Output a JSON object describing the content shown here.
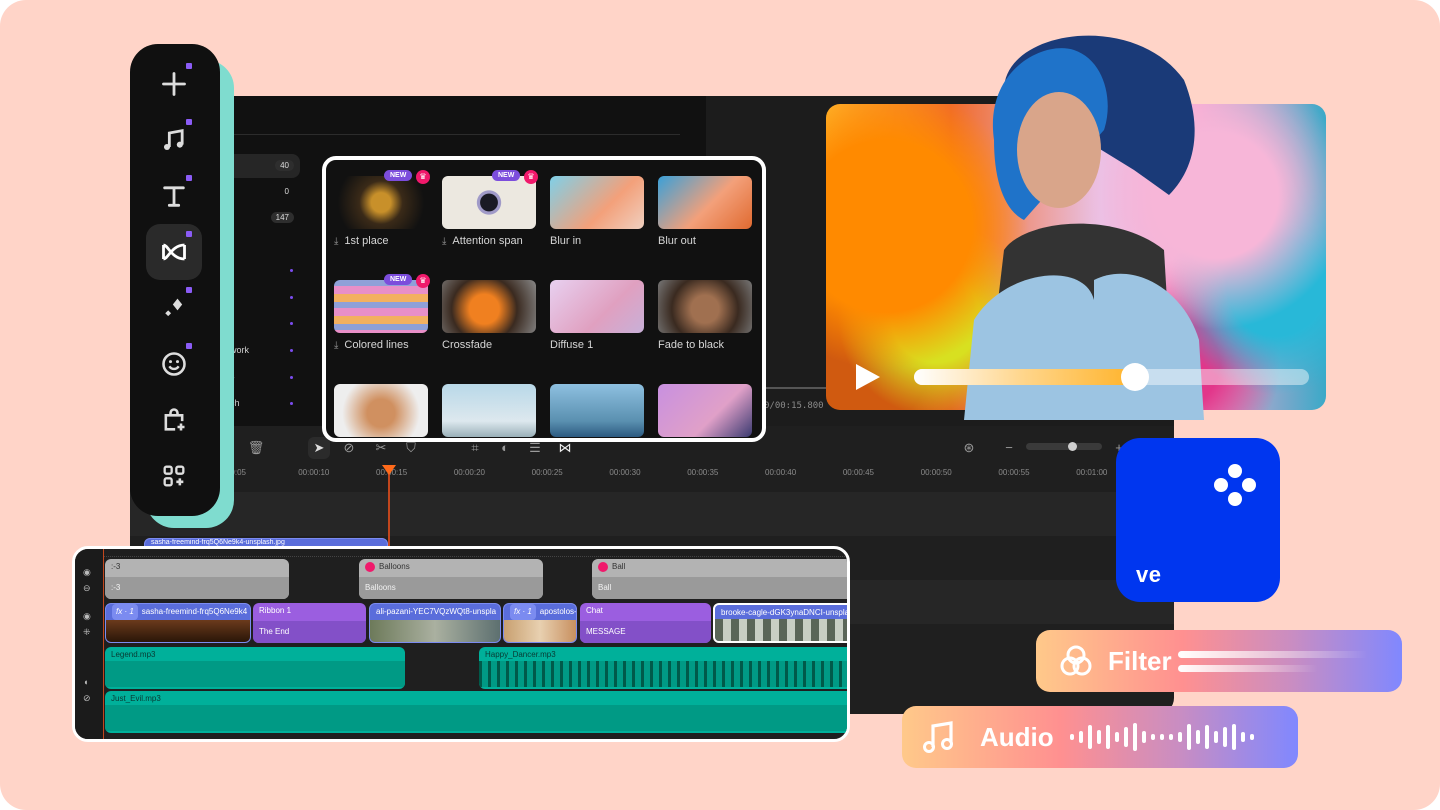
{
  "sidebar": {
    "items": [
      {
        "name": "add",
        "icon": "plus-icon",
        "has_dot": true
      },
      {
        "name": "audio",
        "icon": "music-note-icon",
        "has_dot": true
      },
      {
        "name": "text",
        "icon": "text-icon",
        "has_dot": true
      },
      {
        "name": "transitions",
        "icon": "transition-bowtie-icon",
        "has_dot": true,
        "active": true
      },
      {
        "name": "effects",
        "icon": "sparkle-icon",
        "has_dot": true
      },
      {
        "name": "stickers",
        "icon": "smiley-icon",
        "has_dot": true
      },
      {
        "name": "store",
        "icon": "shopping-bag-plus-icon",
        "has_dot": false
      },
      {
        "name": "more",
        "icon": "apps-plus-icon",
        "has_dot": false
      }
    ],
    "accent_dot_color": "#8b5cf6"
  },
  "categories": {
    "counts": [
      "40",
      "0",
      "147"
    ],
    "partial_labels": [
      "work",
      "s",
      "ch"
    ]
  },
  "transitions_panel": {
    "items": [
      {
        "name": "1st place",
        "downloadable": true,
        "new": true,
        "premium": true,
        "new_label": "NEW"
      },
      {
        "name": "Attention span",
        "downloadable": true,
        "new": true,
        "premium": true,
        "new_label": "NEW"
      },
      {
        "name": "Blur in",
        "downloadable": false,
        "new": false,
        "premium": false
      },
      {
        "name": "Blur out",
        "downloadable": false,
        "new": false,
        "premium": false
      },
      {
        "name": "Colored lines",
        "downloadable": true,
        "new": true,
        "premium": true,
        "new_label": "NEW"
      },
      {
        "name": "Crossfade",
        "downloadable": false,
        "new": false,
        "premium": false
      },
      {
        "name": "Diffuse 1",
        "downloadable": false,
        "new": false,
        "premium": false
      },
      {
        "name": "Fade to black",
        "downloadable": false,
        "new": false,
        "premium": false
      },
      {
        "name": "",
        "downloadable": false
      },
      {
        "name": "",
        "downloadable": false
      },
      {
        "name": "",
        "downloadable": false
      },
      {
        "name": "",
        "downloadable": false
      }
    ]
  },
  "player": {
    "time_readout": "0/00:15.800",
    "progress_fraction": 0.56
  },
  "toolbar": {
    "tools": [
      "delete-icon",
      "select-pointer-icon",
      "unlink-icon",
      "scissors-icon",
      "shield-icon",
      "crop-icon",
      "color-icon",
      "adjust-sliders-icon",
      "transition-add-icon"
    ],
    "zoom_minus": "−",
    "zoom_plus": "+",
    "zoom_level_fraction": 0.6
  },
  "ruler": {
    "labels": [
      "00:05",
      "00:00:10",
      "00:00:15",
      "00:00:20",
      "00:00:25",
      "00:00:30",
      "00:00:35",
      "00:00:40",
      "00:00:45",
      "00:00:50",
      "00:00:55",
      "00:01:00"
    ]
  },
  "timeline": {
    "behind_clip_label": "sasha-freemind-frq5Q6Ne9k4-unsplash.jpg",
    "text_track": [
      {
        "top": ":-3",
        "bottom": ":-3",
        "premium": false
      },
      {
        "top": "Balloons",
        "bottom": "Balloons",
        "premium": true
      },
      {
        "top": "Ball",
        "bottom": "Ball",
        "premium": true
      }
    ],
    "video_track": [
      {
        "label": "sasha-freemind-frq5Q6Ne9k4",
        "fx": "fx · 1",
        "type": "video"
      },
      {
        "label": "Ribbon 1",
        "sub": "The End",
        "type": "text"
      },
      {
        "label": "ali-pazani-YEC7VQzWQt8-unspla",
        "type": "video"
      },
      {
        "label": "apostolos-",
        "fx": "fx · 1",
        "type": "video"
      },
      {
        "label": "Chat",
        "sub": "MESSAGE",
        "type": "text"
      },
      {
        "label": "brooke-cagle-dGK3ynaDNCI-unspla",
        "type": "video"
      }
    ],
    "audio_tracks": [
      {
        "label": "Legend.mp3"
      },
      {
        "label": "Happy_Dancer.mp3"
      },
      {
        "label": "Just_Evil.mp3"
      }
    ]
  },
  "logo": {
    "text": "ve",
    "color": "#0036ef"
  },
  "features": {
    "filter_label": "Filter",
    "audio_label": "Audio"
  }
}
